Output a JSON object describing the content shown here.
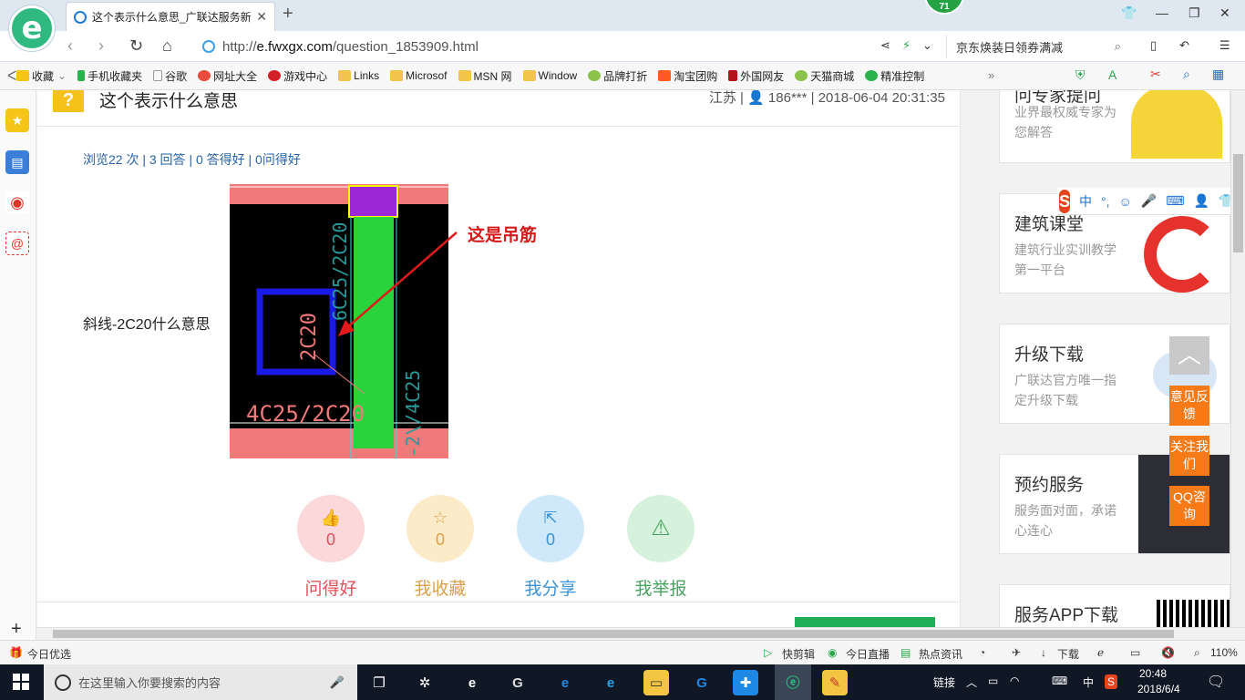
{
  "browser": {
    "tab_title": "这个表示什么意思_广联达服务新",
    "tab_close": "✕",
    "new_tab": "+",
    "badge": "71",
    "url_prefix": "http://",
    "url_domain": "e.fwxgx.com",
    "url_path": "/question_1853909.html",
    "search_text": "京东焕装日领券满减"
  },
  "bookmarks": [
    "收藏",
    "手机收藏夹",
    "谷歌",
    "网址大全",
    "游戏中心",
    "Links",
    "Microsof",
    "MSN 网",
    "Window",
    "品牌打折",
    "淘宝团购",
    "外国网友",
    "天猫商城",
    "精准控制"
  ],
  "question": {
    "title": "这个表示什么意思",
    "meta": "江苏 | 👤 186*** | 2018-06-04 20:31:35",
    "stats": "浏览22 次 | 3 回答 | 0 答得好 | 0问得好",
    "body": "斜线-2C20什么意思",
    "annotation": "这是吊筋",
    "cad_labels": {
      "vertical_left": "6C25/2C20",
      "box": "2C20",
      "bottom": "4C25/2C20",
      "vertical_right": "-2\\/4C25"
    }
  },
  "actions": [
    {
      "label": "问得好",
      "count": "0",
      "icon": "thumb-up-icon",
      "color": "#e0505a",
      "bg": "#fbd8da"
    },
    {
      "label": "我收藏",
      "count": "0",
      "icon": "star-icon",
      "color": "#d9a14a",
      "bg": "#fcebc9"
    },
    {
      "label": "我分享",
      "count": "0",
      "icon": "share-icon",
      "color": "#3b93d6",
      "bg": "#cfe8fa"
    },
    {
      "label": "我举报",
      "count": "",
      "icon": "warning-icon",
      "color": "#4aa360",
      "bg": "#d6f2dc"
    }
  ],
  "sidebar_ads": [
    {
      "title": "问专家提问",
      "sub": "业界最权威专家为您解答"
    },
    {
      "title": "建筑课堂",
      "sub": "建筑行业实训教学第一平台"
    },
    {
      "title": "升级下载",
      "sub": "广联达官方唯一指定升级下载"
    },
    {
      "title": "预约服务",
      "sub": "服务面对面，承诺心连心"
    },
    {
      "title": "服务APP下载",
      "sub": ""
    }
  ],
  "float_buttons": [
    "意见反馈",
    "关注我们",
    "QQ咨询"
  ],
  "sogou_bar": {
    "mode": "中"
  },
  "statusbar": {
    "left": "今日优选",
    "items": [
      "快剪辑",
      "今日直播",
      "热点资讯",
      "下载"
    ],
    "zoom": "110%"
  },
  "taskbar": {
    "search_placeholder": "在这里输入你要搜索的内容",
    "tray_link": "链接",
    "ime": "中",
    "time": "20:48",
    "date": "2018/6/4"
  },
  "colors": {
    "accent_green": "#1fae57",
    "link_blue": "#2a63a8",
    "annotation_red": "#d61818",
    "float_orange": "#f77a17"
  }
}
